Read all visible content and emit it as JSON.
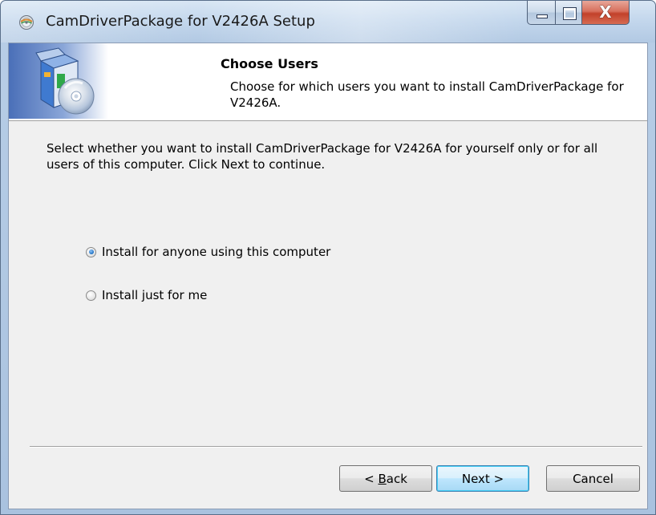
{
  "window": {
    "title": "CamDriverPackage for V2426A Setup",
    "app_icon": "installer-disc-icon",
    "controls": {
      "minimize_icon": "minimize-icon",
      "maximize_icon": "maximize-icon",
      "close_glyph": "X"
    }
  },
  "header": {
    "title": "Choose Users",
    "subtitle": "Choose for which users you want to install CamDriverPackage for V2426A.",
    "image_icon": "software-box-cd-icon"
  },
  "body": {
    "description": "Select whether you want to install CamDriverPackage for V2426A for yourself only or for all users of this computer. Click Next to continue.",
    "options": [
      {
        "label": "Install for anyone using this computer",
        "selected": true
      },
      {
        "label": "Install just for me",
        "selected": false
      }
    ]
  },
  "buttons": {
    "back_prefix": "< ",
    "back_mnemonic": "B",
    "back_suffix": "ack",
    "next": "Next >",
    "cancel": "Cancel"
  },
  "colors": {
    "titlebar": "#c2d6ec",
    "client_bg": "#f0f0f0",
    "close_button": "#c2412a",
    "default_button_border": "#3c7fb1",
    "radio_selected": "#1d6fc4"
  }
}
